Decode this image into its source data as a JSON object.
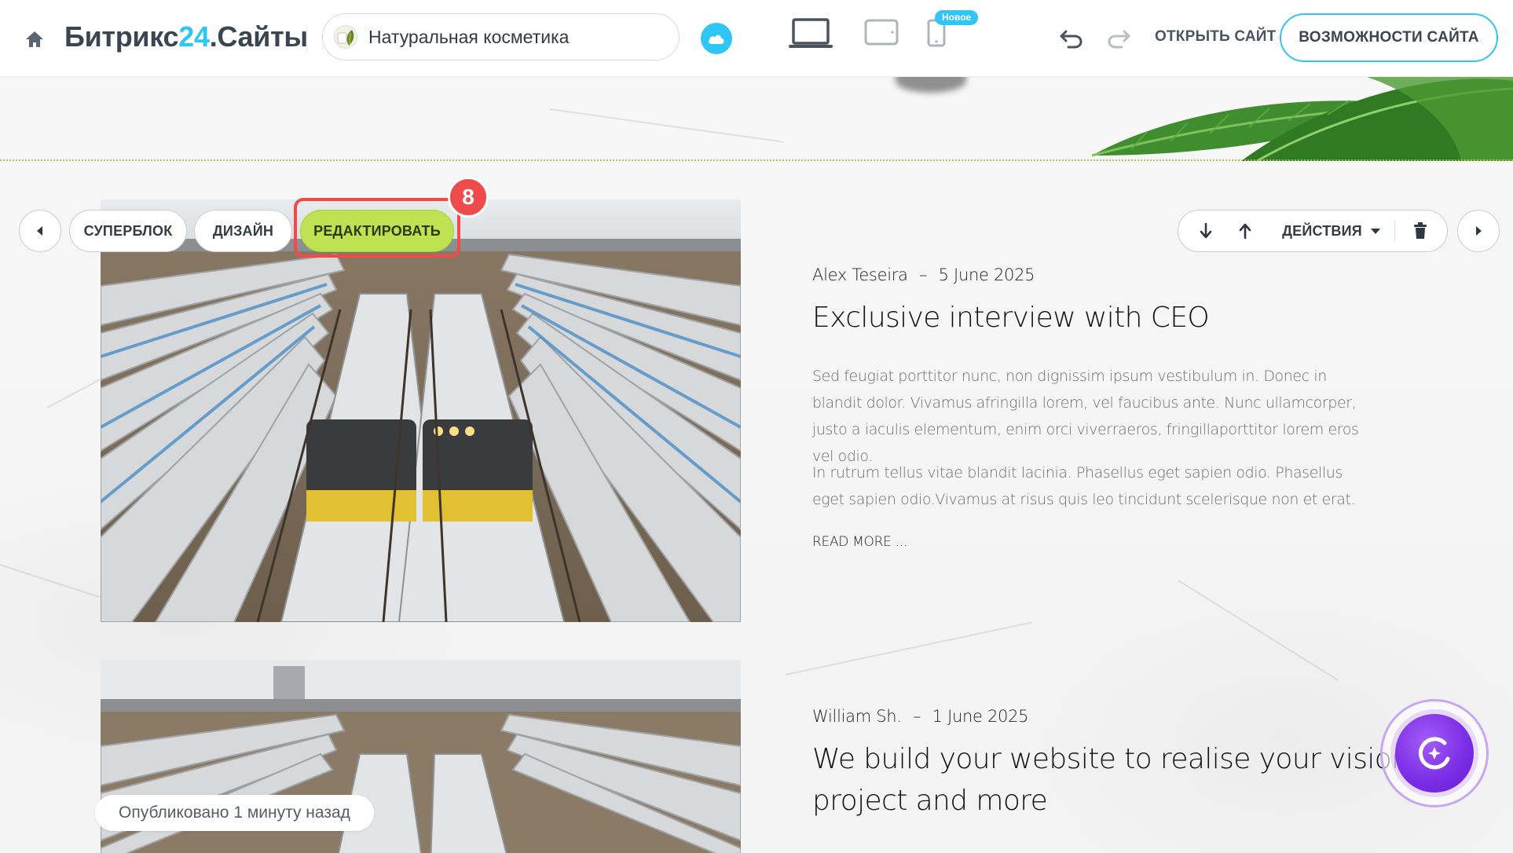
{
  "header": {
    "brand_main": "Битрикс",
    "brand_accent": "24",
    "brand_suffix": ".Сайты",
    "site_name": "Натуральная косметика",
    "new_badge": "Новое",
    "open_site": "ОТКРЫТЬ САЙТ",
    "features": "ВОЗМОЖНОСТИ САЙТА"
  },
  "block_toolbar": {
    "superblock": "СУПЕРБЛОК",
    "design": "ДИЗАЙН",
    "edit": "РЕДАКТИРОВАТЬ",
    "step_number": "8",
    "actions": "ДЕЙСТВИЯ"
  },
  "articles": [
    {
      "author": "Alex Teseira",
      "separator": "–",
      "date": "5 June 2025",
      "title": "Exclusive interview with CEO",
      "paragraphs": [
        "Sed feugiat porttitor nunc, non dignissim ipsum vestibulum in. Donec in blandit dolor. Vivamus afringilla lorem, vel faucibus ante. Nunc ullamcorper, justo a iaculis elementum, enim orci viverraeros, fringillaporttitor lorem eros vel odio.",
        "In rutrum tellus vitae blandit lacinia. Phasellus eget sapien odio. Phasellus eget sapien odio.Vivamus at risus quis leo tincidunt scelerisque non et erat."
      ],
      "read_more": "READ MORE ..."
    },
    {
      "author": "William Sh.",
      "separator": "–",
      "date": "1 June 2025",
      "title_line1": "We build your website to realise your vision,",
      "title_line2": "project and more"
    }
  ],
  "status": {
    "published": "Опубликовано 1 минуту назад"
  },
  "colors": {
    "accent": "#2fc6f6",
    "edit_button": "#bde352",
    "highlight": "#ef4b4b",
    "ai_purple": "#7a2be5"
  }
}
